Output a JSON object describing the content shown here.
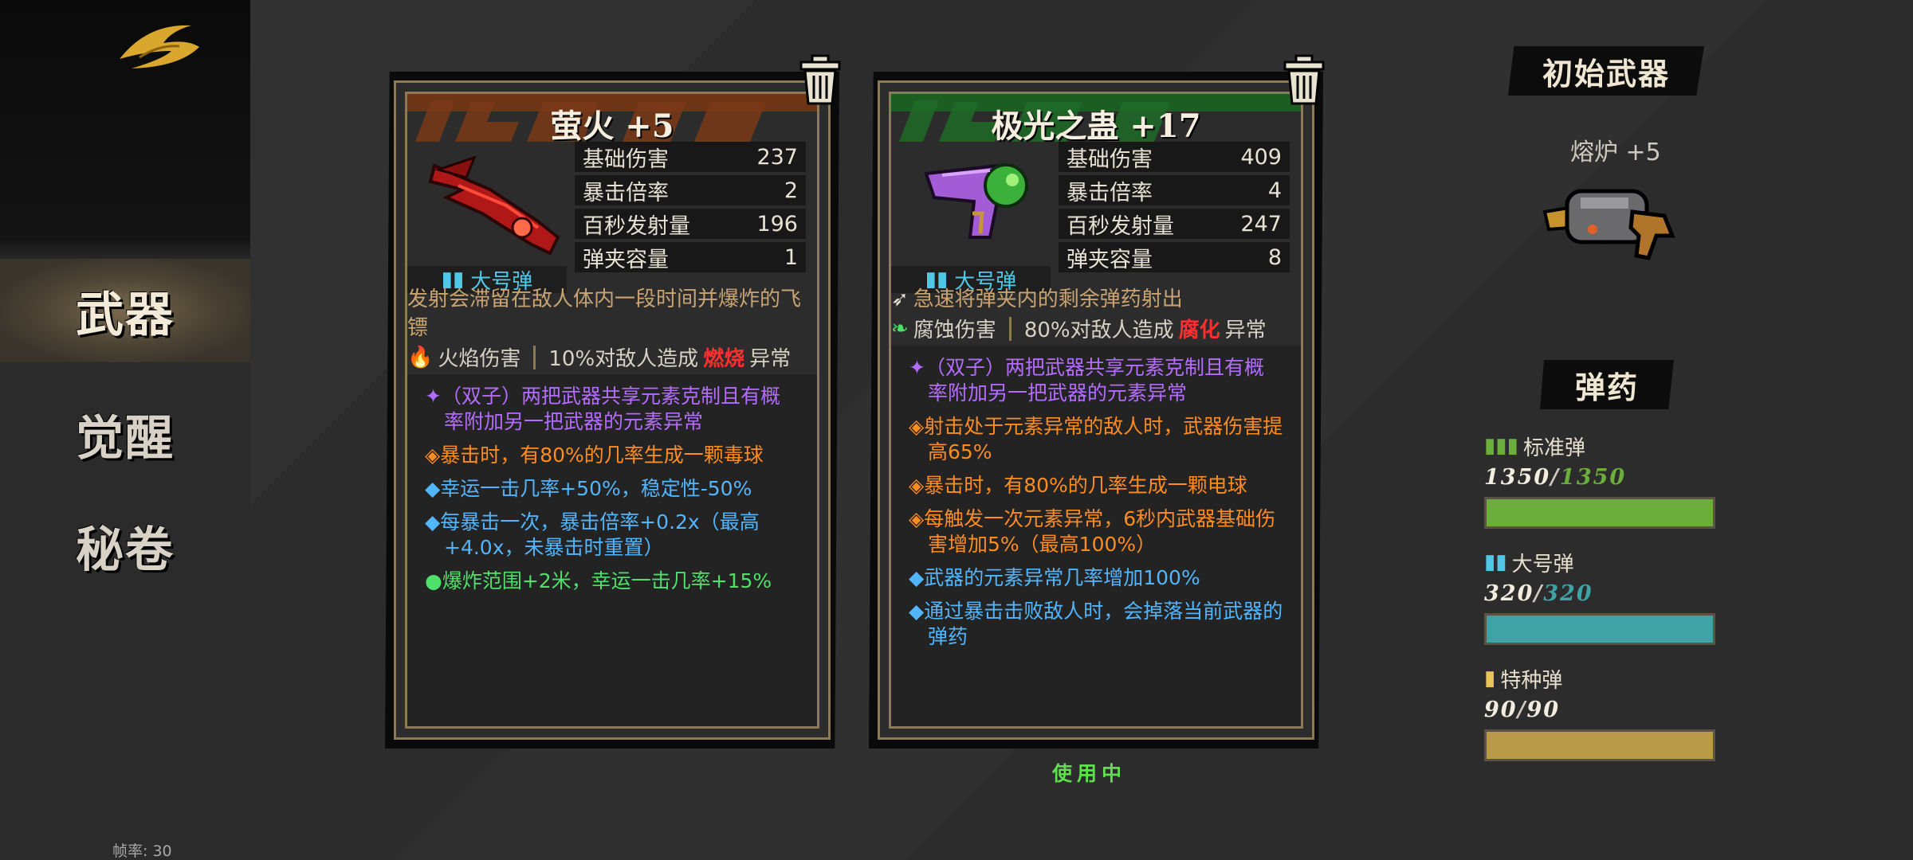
{
  "sidebar": {
    "items": [
      {
        "label": "武器",
        "active": true
      },
      {
        "label": "觉醒",
        "active": false
      },
      {
        "label": "秘卷",
        "active": false
      }
    ],
    "fps_label": "帧率: 30"
  },
  "weapons": [
    {
      "title": "萤火 +5",
      "stripe_color": "#7a3a18",
      "ammo_type": "大号弹",
      "stats": [
        {
          "label": "基础伤害",
          "value": "237"
        },
        {
          "label": "暴击倍率",
          "value": "2"
        },
        {
          "label": "百秒发射量",
          "value": "196"
        },
        {
          "label": "弹夹容量",
          "value": "1"
        }
      ],
      "description": "发射会滞留在敌人体内一段时间并爆炸的飞镖",
      "damage_type": "火焰伤害",
      "status_prefix": "10%对敌人造成",
      "status_name": "燃烧",
      "status_suffix": "异常",
      "effects": [
        {
          "color": "purple",
          "text": "✦（双子）两把武器共享元素克制且有概率附加另一把武器的元素异常"
        },
        {
          "color": "orange",
          "text": "◈暴击时，有80%的几率生成一颗毒球"
        },
        {
          "color": "blue",
          "text": "◆幸运一击几率+50%，稳定性-50%"
        },
        {
          "color": "blue",
          "text": "◆每暴击一次，暴击倍率+0.2x（最高+4.0x，未暴击时重置）"
        },
        {
          "color": "green",
          "text": "●爆炸范围+2米，幸运一击几率+15%"
        }
      ]
    },
    {
      "title": "极光之蛊 +17",
      "stripe_color": "#1f6b28",
      "ammo_type": "大号弹",
      "stats": [
        {
          "label": "基础伤害",
          "value": "409"
        },
        {
          "label": "暴击倍率",
          "value": "4"
        },
        {
          "label": "百秒发射量",
          "value": "247"
        },
        {
          "label": "弹夹容量",
          "value": "8"
        }
      ],
      "description": "急速将弹夹内的剩余弹药射出",
      "damage_type": "腐蚀伤害",
      "status_prefix": "80%对敌人造成",
      "status_name": "腐化",
      "status_suffix": "异常",
      "in_use_label": "使用中",
      "effects": [
        {
          "color": "purple",
          "text": "✦（双子）两把武器共享元素克制且有概率附加另一把武器的元素异常"
        },
        {
          "color": "orange",
          "text": "◈射击处于元素异常的敌人时，武器伤害提高65%"
        },
        {
          "color": "orange",
          "text": "◈暴击时，有80%的几率生成一颗电球"
        },
        {
          "color": "orange",
          "text": "◈每触发一次元素异常，6秒内武器基础伤害增加5%（最高100%）"
        },
        {
          "color": "blue",
          "text": "◆武器的元素异常几率增加100%"
        },
        {
          "color": "blue",
          "text": "◆通过暴击击败敌人时，会掉落当前武器的弹药"
        }
      ]
    }
  ],
  "starting_weapon": {
    "heading": "初始武器",
    "name": "熔炉 +5"
  },
  "ammo": {
    "heading": "弹药",
    "types": [
      {
        "name": "标准弹",
        "count": "1350",
        "max": "1350",
        "fraction": 1.0,
        "color": "#6cae3c",
        "icon": "standard-ammo-icon"
      },
      {
        "name": "大号弹",
        "count": "320",
        "max": "320",
        "fraction": 1.0,
        "color": "#3fa3a6",
        "icon": "heavy-ammo-icon"
      },
      {
        "name": "特种弹",
        "count": "90",
        "max": "90",
        "fraction": 1.0,
        "color": "#b89a48",
        "icon": "special-ammo-icon"
      }
    ]
  }
}
